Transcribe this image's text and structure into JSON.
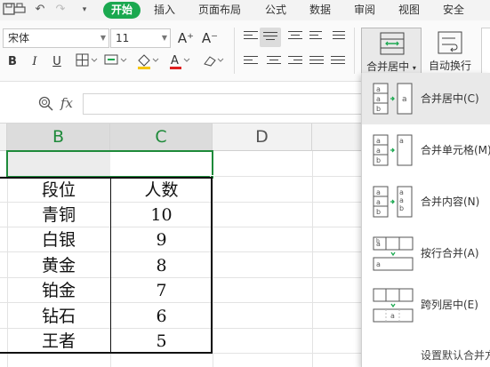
{
  "menubar": {
    "tabs": [
      "开始",
      "插入",
      "页面布局",
      "公式",
      "数据",
      "审阅",
      "视图",
      "安全"
    ]
  },
  "ribbon": {
    "font_name": "宋体",
    "font_size": "11",
    "bold": "B",
    "italic": "I",
    "underline": "U",
    "grow_font": "A⁺",
    "shrink_font": "A⁻",
    "merge_center": "合并居中",
    "auto_wrap": "自动换行"
  },
  "formula_bar": {
    "fx": "fx",
    "value": ""
  },
  "sheet": {
    "columns": [
      "B",
      "C",
      "D"
    ],
    "selected_columns": [
      "B",
      "C"
    ],
    "rows": [
      [
        "段位",
        "人数"
      ],
      [
        "青铜",
        "10"
      ],
      [
        "白银",
        "9"
      ],
      [
        "黄金",
        "8"
      ],
      [
        "铂金",
        "7"
      ],
      [
        "钻石",
        "6"
      ],
      [
        "王者",
        "5"
      ]
    ]
  },
  "merge_menu": {
    "items": [
      "合并居中(C)",
      "合并单元格(M)",
      "合并内容(N)",
      "按行合并(A)",
      "跨列居中(E)",
      "设置默认合并方式"
    ],
    "selected_index": 0
  },
  "colors": {
    "accent_green": "#1aa84f",
    "selection_green": "#1e8a3a",
    "highlight_yellow": "#f6c500",
    "font_red": "#e02020"
  }
}
